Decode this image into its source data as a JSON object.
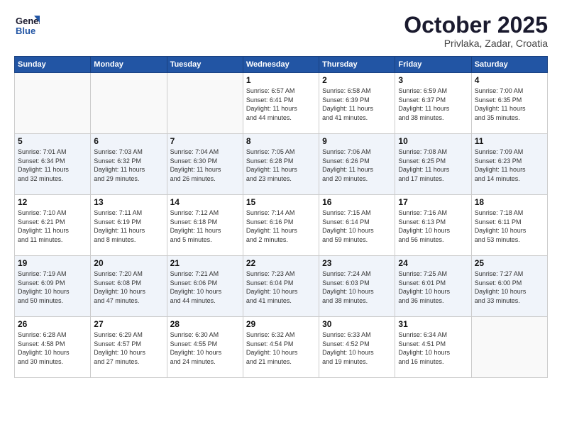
{
  "header": {
    "logo_line1": "General",
    "logo_line2": "Blue",
    "month": "October 2025",
    "location": "Privlaka, Zadar, Croatia"
  },
  "days_of_week": [
    "Sunday",
    "Monday",
    "Tuesday",
    "Wednesday",
    "Thursday",
    "Friday",
    "Saturday"
  ],
  "weeks": [
    [
      {
        "num": "",
        "info": ""
      },
      {
        "num": "",
        "info": ""
      },
      {
        "num": "",
        "info": ""
      },
      {
        "num": "1",
        "info": "Sunrise: 6:57 AM\nSunset: 6:41 PM\nDaylight: 11 hours\nand 44 minutes."
      },
      {
        "num": "2",
        "info": "Sunrise: 6:58 AM\nSunset: 6:39 PM\nDaylight: 11 hours\nand 41 minutes."
      },
      {
        "num": "3",
        "info": "Sunrise: 6:59 AM\nSunset: 6:37 PM\nDaylight: 11 hours\nand 38 minutes."
      },
      {
        "num": "4",
        "info": "Sunrise: 7:00 AM\nSunset: 6:35 PM\nDaylight: 11 hours\nand 35 minutes."
      }
    ],
    [
      {
        "num": "5",
        "info": "Sunrise: 7:01 AM\nSunset: 6:34 PM\nDaylight: 11 hours\nand 32 minutes."
      },
      {
        "num": "6",
        "info": "Sunrise: 7:03 AM\nSunset: 6:32 PM\nDaylight: 11 hours\nand 29 minutes."
      },
      {
        "num": "7",
        "info": "Sunrise: 7:04 AM\nSunset: 6:30 PM\nDaylight: 11 hours\nand 26 minutes."
      },
      {
        "num": "8",
        "info": "Sunrise: 7:05 AM\nSunset: 6:28 PM\nDaylight: 11 hours\nand 23 minutes."
      },
      {
        "num": "9",
        "info": "Sunrise: 7:06 AM\nSunset: 6:26 PM\nDaylight: 11 hours\nand 20 minutes."
      },
      {
        "num": "10",
        "info": "Sunrise: 7:08 AM\nSunset: 6:25 PM\nDaylight: 11 hours\nand 17 minutes."
      },
      {
        "num": "11",
        "info": "Sunrise: 7:09 AM\nSunset: 6:23 PM\nDaylight: 11 hours\nand 14 minutes."
      }
    ],
    [
      {
        "num": "12",
        "info": "Sunrise: 7:10 AM\nSunset: 6:21 PM\nDaylight: 11 hours\nand 11 minutes."
      },
      {
        "num": "13",
        "info": "Sunrise: 7:11 AM\nSunset: 6:19 PM\nDaylight: 11 hours\nand 8 minutes."
      },
      {
        "num": "14",
        "info": "Sunrise: 7:12 AM\nSunset: 6:18 PM\nDaylight: 11 hours\nand 5 minutes."
      },
      {
        "num": "15",
        "info": "Sunrise: 7:14 AM\nSunset: 6:16 PM\nDaylight: 11 hours\nand 2 minutes."
      },
      {
        "num": "16",
        "info": "Sunrise: 7:15 AM\nSunset: 6:14 PM\nDaylight: 10 hours\nand 59 minutes."
      },
      {
        "num": "17",
        "info": "Sunrise: 7:16 AM\nSunset: 6:13 PM\nDaylight: 10 hours\nand 56 minutes."
      },
      {
        "num": "18",
        "info": "Sunrise: 7:18 AM\nSunset: 6:11 PM\nDaylight: 10 hours\nand 53 minutes."
      }
    ],
    [
      {
        "num": "19",
        "info": "Sunrise: 7:19 AM\nSunset: 6:09 PM\nDaylight: 10 hours\nand 50 minutes."
      },
      {
        "num": "20",
        "info": "Sunrise: 7:20 AM\nSunset: 6:08 PM\nDaylight: 10 hours\nand 47 minutes."
      },
      {
        "num": "21",
        "info": "Sunrise: 7:21 AM\nSunset: 6:06 PM\nDaylight: 10 hours\nand 44 minutes."
      },
      {
        "num": "22",
        "info": "Sunrise: 7:23 AM\nSunset: 6:04 PM\nDaylight: 10 hours\nand 41 minutes."
      },
      {
        "num": "23",
        "info": "Sunrise: 7:24 AM\nSunset: 6:03 PM\nDaylight: 10 hours\nand 38 minutes."
      },
      {
        "num": "24",
        "info": "Sunrise: 7:25 AM\nSunset: 6:01 PM\nDaylight: 10 hours\nand 36 minutes."
      },
      {
        "num": "25",
        "info": "Sunrise: 7:27 AM\nSunset: 6:00 PM\nDaylight: 10 hours\nand 33 minutes."
      }
    ],
    [
      {
        "num": "26",
        "info": "Sunrise: 6:28 AM\nSunset: 4:58 PM\nDaylight: 10 hours\nand 30 minutes."
      },
      {
        "num": "27",
        "info": "Sunrise: 6:29 AM\nSunset: 4:57 PM\nDaylight: 10 hours\nand 27 minutes."
      },
      {
        "num": "28",
        "info": "Sunrise: 6:30 AM\nSunset: 4:55 PM\nDaylight: 10 hours\nand 24 minutes."
      },
      {
        "num": "29",
        "info": "Sunrise: 6:32 AM\nSunset: 4:54 PM\nDaylight: 10 hours\nand 21 minutes."
      },
      {
        "num": "30",
        "info": "Sunrise: 6:33 AM\nSunset: 4:52 PM\nDaylight: 10 hours\nand 19 minutes."
      },
      {
        "num": "31",
        "info": "Sunrise: 6:34 AM\nSunset: 4:51 PM\nDaylight: 10 hours\nand 16 minutes."
      },
      {
        "num": "",
        "info": ""
      }
    ]
  ]
}
